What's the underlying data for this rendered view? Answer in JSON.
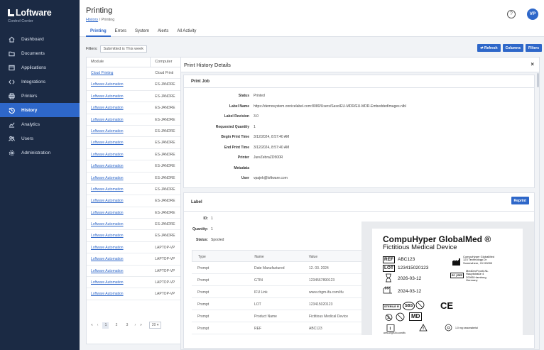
{
  "brand": {
    "name": "Loftware",
    "subtitle": "Control Center"
  },
  "nav": [
    {
      "label": "Dashboard",
      "icon": "home-icon"
    },
    {
      "label": "Documents",
      "icon": "folder-icon"
    },
    {
      "label": "Applications",
      "icon": "window-icon"
    },
    {
      "label": "Integrations",
      "icon": "code-icon"
    },
    {
      "label": "Printers",
      "icon": "printer-icon"
    },
    {
      "label": "History",
      "icon": "history-icon",
      "active": true
    },
    {
      "label": "Analytics",
      "icon": "chart-icon"
    },
    {
      "label": "Users",
      "icon": "users-icon"
    },
    {
      "label": "Administration",
      "icon": "gear-icon"
    }
  ],
  "header": {
    "title": "Printing",
    "breadcrumb_link": "History",
    "breadcrumb_current": "Printing",
    "separator": "/",
    "help": "?",
    "avatar": "VP"
  },
  "tabs": [
    {
      "label": "Printing",
      "active": true
    },
    {
      "label": "Errors"
    },
    {
      "label": "System"
    },
    {
      "label": "Alerts"
    },
    {
      "label": "All Activity"
    }
  ],
  "filters": {
    "label": "Filters:",
    "chip": "Submitted is This week"
  },
  "buttons": {
    "refresh": "⇄ Refresh",
    "columns": "Columns",
    "filters": "Filters"
  },
  "grid": {
    "columns": [
      "Module",
      "Computer"
    ],
    "rows": [
      [
        "Cloud Printing",
        "Cloud Printi"
      ],
      [
        "Loftware Automation",
        "ES-JANDRE"
      ],
      [
        "Loftware Automation",
        "ES-JANDRE"
      ],
      [
        "Loftware Automation",
        "ES-JANDRE"
      ],
      [
        "Loftware Automation",
        "ES-JANDRE"
      ],
      [
        "Loftware Automation",
        "ES-JANDRE"
      ],
      [
        "Loftware Automation",
        "ES-JANDRE"
      ],
      [
        "Loftware Automation",
        "ES-JANDRE"
      ],
      [
        "Loftware Automation",
        "ES-JANDRE"
      ],
      [
        "Loftware Automation",
        "ES-JANDRE"
      ],
      [
        "Loftware Automation",
        "ES-JANDRE"
      ],
      [
        "Loftware Automation",
        "ES-JANDRE"
      ],
      [
        "Loftware Automation",
        "ES-JANDRE"
      ],
      [
        "Loftware Automation",
        "ES-JANDRE"
      ],
      [
        "Loftware Automation",
        "ES-JANDRE"
      ],
      [
        "Loftware Automation",
        "LAPTOP-VP"
      ],
      [
        "Loftware Automation",
        "LAPTOP-VP"
      ],
      [
        "Loftware Automation",
        "LAPTOP-VP"
      ],
      [
        "Loftware Automation",
        "LAPTOP-VP"
      ],
      [
        "Loftware Automation",
        "LAPTOP-VP"
      ]
    ]
  },
  "pager": {
    "first": "«",
    "prev": "‹",
    "pages": [
      "1",
      "2",
      "3"
    ],
    "next": "›",
    "last": "»",
    "page_size": "20 ▾"
  },
  "details": {
    "title": "Print History Details",
    "close": "×",
    "job_title": "Print Job",
    "job": [
      {
        "k": "Status",
        "v": "Printed"
      },
      {
        "k": "Label Name",
        "v": "https://demosystem.onnicelabel.com:8080/Users/Saso/EU-MDR/EU-MDR-EmbeddedImages.nlbl"
      },
      {
        "k": "Label Revision",
        "v": "3.0"
      },
      {
        "k": "Requested Quantity",
        "v": "1"
      },
      {
        "k": "Begin Print Time",
        "v": "3/12/2024, 8:57:40 AM"
      },
      {
        "k": "End Print Time",
        "v": "3/12/2024, 8:57:40 AM"
      },
      {
        "k": "Printer",
        "v": "JureZebraZD500R"
      },
      {
        "k": "Metadata",
        "v": ""
      },
      {
        "k": "User",
        "v": "vpajek@loftware.com"
      }
    ],
    "label_title": "Label",
    "reprint": "Reprint",
    "label_info": [
      {
        "k": "ID:",
        "v": "1"
      },
      {
        "k": "Quantity:",
        "v": "1"
      },
      {
        "k": "Status:",
        "v": "Spooled"
      }
    ],
    "table_head": [
      "Type",
      "Name",
      "Value"
    ],
    "table_rows": [
      [
        "Prompt",
        "Date Manufactured",
        "12. 03. 2024"
      ],
      [
        "Prompt",
        "GTIN",
        "1234567890123"
      ],
      [
        "Prompt",
        "IFU Link",
        "www.chgm-ifu.com/ifu"
      ],
      [
        "Prompt",
        "LOT",
        "123415020123"
      ],
      [
        "Prompt",
        "Product Name",
        "Fictitious Medical Device"
      ],
      [
        "Prompt",
        "REF",
        "ABC123"
      ]
    ]
  },
  "label_preview": {
    "brand": "CompuHyper GlobalMed ®",
    "product": "Fictitious Medical Device",
    "ref_sym": "REF",
    "ref": "ABC123",
    "lot_sym": "LOT",
    "lot": "123415020123",
    "expiry": "2026-03-12",
    "mfg_date": "2024-03-12",
    "manufacturer": [
      "CompuHyper GlobalMed",
      "123 Technology Dr",
      "Somewhere, XX 00000"
    ],
    "ec_sym": "EC",
    "rep_sym": "REP",
    "rep": [
      "MedDevFrontl-NL",
      "Hauptstraße 4",
      "20095 Hamburg",
      "Germany"
    ],
    "sterile": "STERILE R",
    "sbs": "SBS",
    "md": "MD",
    "ce": "CE",
    "ifu_url": "www.chgm-ifu.com/ifu",
    "nano": "1.0 mg nanomaterial"
  }
}
